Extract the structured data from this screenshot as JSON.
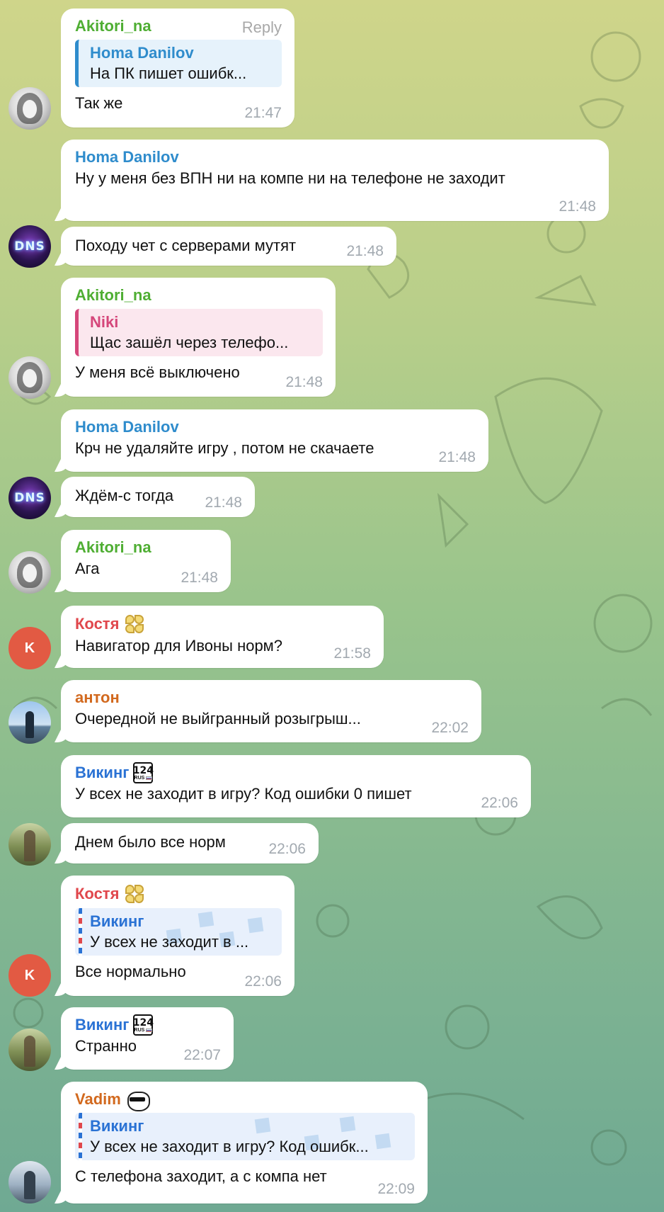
{
  "ui": {
    "reply_label": "Reply"
  },
  "messages": [
    {
      "sender": "Akitori_na",
      "quote": {
        "name": "Homa Danilov",
        "text": "На ПК пишет ошибк..."
      },
      "text": "Так же",
      "time": "21:47"
    },
    {
      "sender": "Homa Danilov",
      "text": "Ну у меня без ВПН ни на компе ни на телефоне не заходит",
      "time": "21:48"
    },
    {
      "text": "Походу чет с серверами мутят",
      "time": "21:48"
    },
    {
      "sender": "Akitori_na",
      "quote": {
        "name": "Niki",
        "text": "Щас зашёл через телефо..."
      },
      "text": "У меня всё выключено",
      "time": "21:48"
    },
    {
      "sender": "Homa Danilov",
      "text": "Крч не удаляйте игру , потом не скачаете",
      "time": "21:48"
    },
    {
      "text": "Ждём-с тогда",
      "time": "21:48"
    },
    {
      "sender": "Akitori_na",
      "text": "Ага",
      "time": "21:48"
    },
    {
      "sender": "Костя",
      "text": "Навигатор для Ивоны норм?",
      "time": "21:58"
    },
    {
      "sender": "антон",
      "text": "Очередной не выйгранный розыгрыш...",
      "time": "22:02"
    },
    {
      "sender": "Викинг",
      "text": "У всех не заходит в игру? Код ошибки 0 пишет",
      "time": "22:06"
    },
    {
      "text": "Днем было все норм",
      "time": "22:06"
    },
    {
      "sender": "Костя",
      "quote": {
        "name": "Викинг",
        "text": "У всех не заходит в ..."
      },
      "text": "Все нормально",
      "time": "22:06"
    },
    {
      "sender": "Викинг",
      "text": "Странно",
      "time": "22:07"
    },
    {
      "sender": "Vadim",
      "quote": {
        "name": "Викинг",
        "text": "У всех не заходит в игру? Код ошибк..."
      },
      "text": "С телефона заходит, а с компа нет",
      "time": "22:09"
    }
  ],
  "avatars": {
    "kostya_initial": "K",
    "dns_label": "DNS"
  },
  "badges": {
    "viking_plate_number": "124",
    "viking_plate_region": "RUS"
  },
  "colors": {
    "akitori": "#4fae33",
    "homa": "#2f8ccc",
    "kostya": "#e0474c",
    "anton": "#d2691e",
    "viking": "#2a72d4",
    "vadim": "#d2691e",
    "niki": "#d5467a"
  },
  "icons": [
    "clover-emoji-icon",
    "license-plate-emoji-icon",
    "sunglasses-cat-emoji-icon"
  ]
}
